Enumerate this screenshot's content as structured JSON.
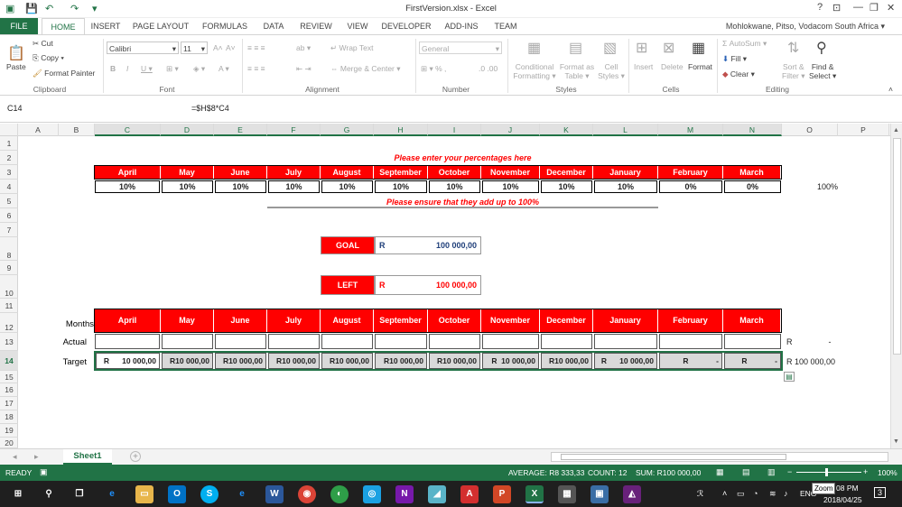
{
  "window": {
    "title": "FirstVersion.xlsx - Excel",
    "user": "Mohlokwane, Pitso, Vodacom South Africa",
    "help": "?",
    "minimize": "—",
    "restore": "❐",
    "close": "✕"
  },
  "ribbon_tabs": [
    "FILE",
    "HOME",
    "INSERT",
    "PAGE LAYOUT",
    "FORMULAS",
    "DATA",
    "REVIEW",
    "VIEW",
    "DEVELOPER",
    "ADD-INS",
    "TEAM"
  ],
  "clipboard": {
    "cut": "Cut",
    "copy": "Copy",
    "paste": "Paste",
    "format_painter": "Format Painter",
    "label": "Clipboard"
  },
  "font": {
    "name": "Calibri",
    "size": "11",
    "label": "Font"
  },
  "alignment": {
    "wrap": "Wrap Text",
    "merge": "Merge & Center",
    "label": "Alignment"
  },
  "number": {
    "format": "General",
    "label": "Number"
  },
  "styles": {
    "cond": "Conditional",
    "cond2": "Formatting",
    "fmt_table": "Format as",
    "fmt_table2": "Table",
    "cell_styles": "Cell",
    "cell_styles2": "Styles",
    "label": "Styles"
  },
  "cells": {
    "insert": "Insert",
    "delete": "Delete",
    "format": "Format",
    "label": "Cells"
  },
  "editing": {
    "autosum": "AutoSum",
    "fill": "Fill",
    "clear": "Clear",
    "sort": "Sort &",
    "sort2": "Filter",
    "find": "Find &",
    "find2": "Select",
    "label": "Editing"
  },
  "formula_bar": {
    "name_box": "C14",
    "formula": "=$H$8*C4"
  },
  "columns": [
    "A",
    "B",
    "C",
    "D",
    "E",
    "F",
    "G",
    "H",
    "I",
    "J",
    "K",
    "L",
    "M",
    "N",
    "O",
    "P"
  ],
  "rows": [
    "1",
    "2",
    "3",
    "4",
    "5",
    "6",
    "7",
    "8",
    "9",
    "10",
    "11",
    "12",
    "13",
    "14",
    "15",
    "16",
    "17",
    "18",
    "19",
    "20"
  ],
  "sheet": {
    "prompt": "Please enter your percentages here",
    "months": [
      "April",
      "May",
      "June",
      "July",
      "August",
      "September",
      "October",
      "November",
      "December",
      "January",
      "February",
      "March"
    ],
    "percentages": [
      "10%",
      "10%",
      "10%",
      "10%",
      "10%",
      "10%",
      "10%",
      "10%",
      "10%",
      "10%",
      "0%",
      "0%"
    ],
    "total_pct": "100%",
    "warning": "Please ensure that they add up to 100%",
    "goal_label": "GOAL",
    "goal_currency": "R",
    "goal_value": "100 000,00",
    "left_label": "LEFT",
    "left_currency": "R",
    "left_value": "100 000,00",
    "row_labels": {
      "months": "Months",
      "actual": "Actual",
      "target": "Target"
    },
    "actual_total": "R                -",
    "targets": [
      "R      10 000,00",
      "R10 000,00",
      "R10 000,00",
      "R10 000,00",
      "R10 000,00",
      "R10 000,00",
      "R10 000,00",
      "R  10 000,00",
      "R10 000,00",
      "R      10 000,00",
      "R             -",
      "R             -"
    ],
    "target_total": "R 100 000,00"
  },
  "sheet_tab": "Sheet1",
  "status": {
    "ready": "READY",
    "average": "AVERAGE:  R8 333,33",
    "count": "COUNT: 12",
    "sum": "SUM:  R100 000,00",
    "zoom": "100%"
  },
  "taskbar": {
    "time": "08 PM",
    "date": "2018/04/25",
    "lang": "ENG",
    "tooltip": "Zoom",
    "notif": "3"
  }
}
